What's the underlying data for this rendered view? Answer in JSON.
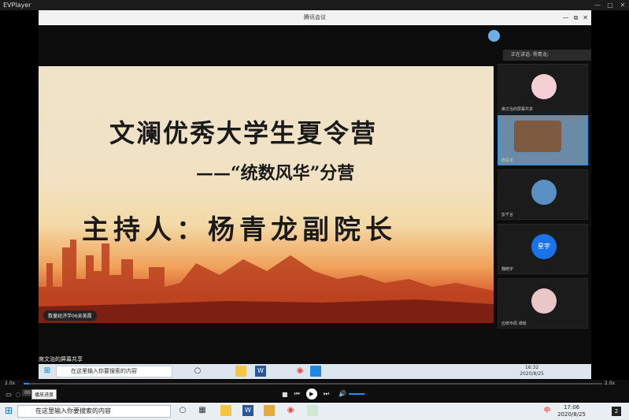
{
  "player": {
    "title": "EVPlayer",
    "win_buttons": [
      "—",
      "□",
      "✕"
    ]
  },
  "meeting": {
    "title": "腾讯会议",
    "win_buttons": [
      "—",
      "⧉",
      "✕"
    ],
    "speaking": "正在讲话: 杨青龙;",
    "slide": {
      "title": "文澜优秀大学生夏令营",
      "subtitle": "——“统数风华”分营",
      "host": "主持人：杨青龙副院长",
      "tag": "数量经济学06吴美霞"
    },
    "participants": [
      {
        "name": "席文治的屏幕共享",
        "avatar_color": "#f4d0d6"
      },
      {
        "name": "杨青龙",
        "avatar_color": "#7d5a40"
      },
      {
        "name": "彭千言",
        "avatar_color": "#5a8fc4"
      },
      {
        "name": "魏皓宇",
        "avatar_color": "#1a73e8",
        "initials": "星宇"
      },
      {
        "name": "应统专硕 谭瑶",
        "avatar_color": "#e9c7c7"
      }
    ],
    "share_label": "席文治的屏幕共享"
  },
  "inner_taskbar": {
    "search_placeholder": "在这里输入你要搜索的内容",
    "time": "16:32",
    "date": "2020/8/25"
  },
  "player_bar": {
    "speed_left": "2.0x",
    "speed_right": "2.0x",
    "progress": 0.01,
    "time_short": "00",
    "tooltip": "播放进度"
  },
  "taskbar": {
    "search_placeholder": "在这里输入你要搜索的内容",
    "time": "17:06",
    "date": "2020/8/25",
    "notif": "2",
    "ime": "中"
  },
  "colors": {
    "accent": "#1e90ff",
    "slide_warm": "#d7572b"
  }
}
